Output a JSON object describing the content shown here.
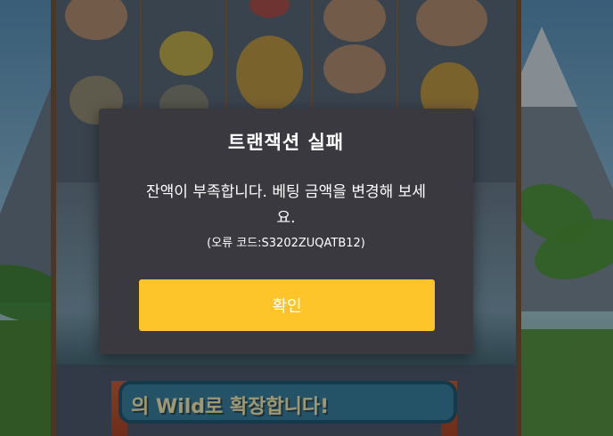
{
  "game": {
    "banner_text": "의 Wild로 확장합니다!"
  },
  "dialog": {
    "title": "트랜잭션 실패",
    "message": "잔액이 부족합니다. 베팅 금액을 변경해 보세요.",
    "error_code": "(오류 코드:S3202ZUQATB12)",
    "confirm_label": "확인"
  },
  "colors": {
    "dialog_bg": "#3a393f",
    "confirm_button": "#fdc529",
    "text": "#ffffff"
  }
}
